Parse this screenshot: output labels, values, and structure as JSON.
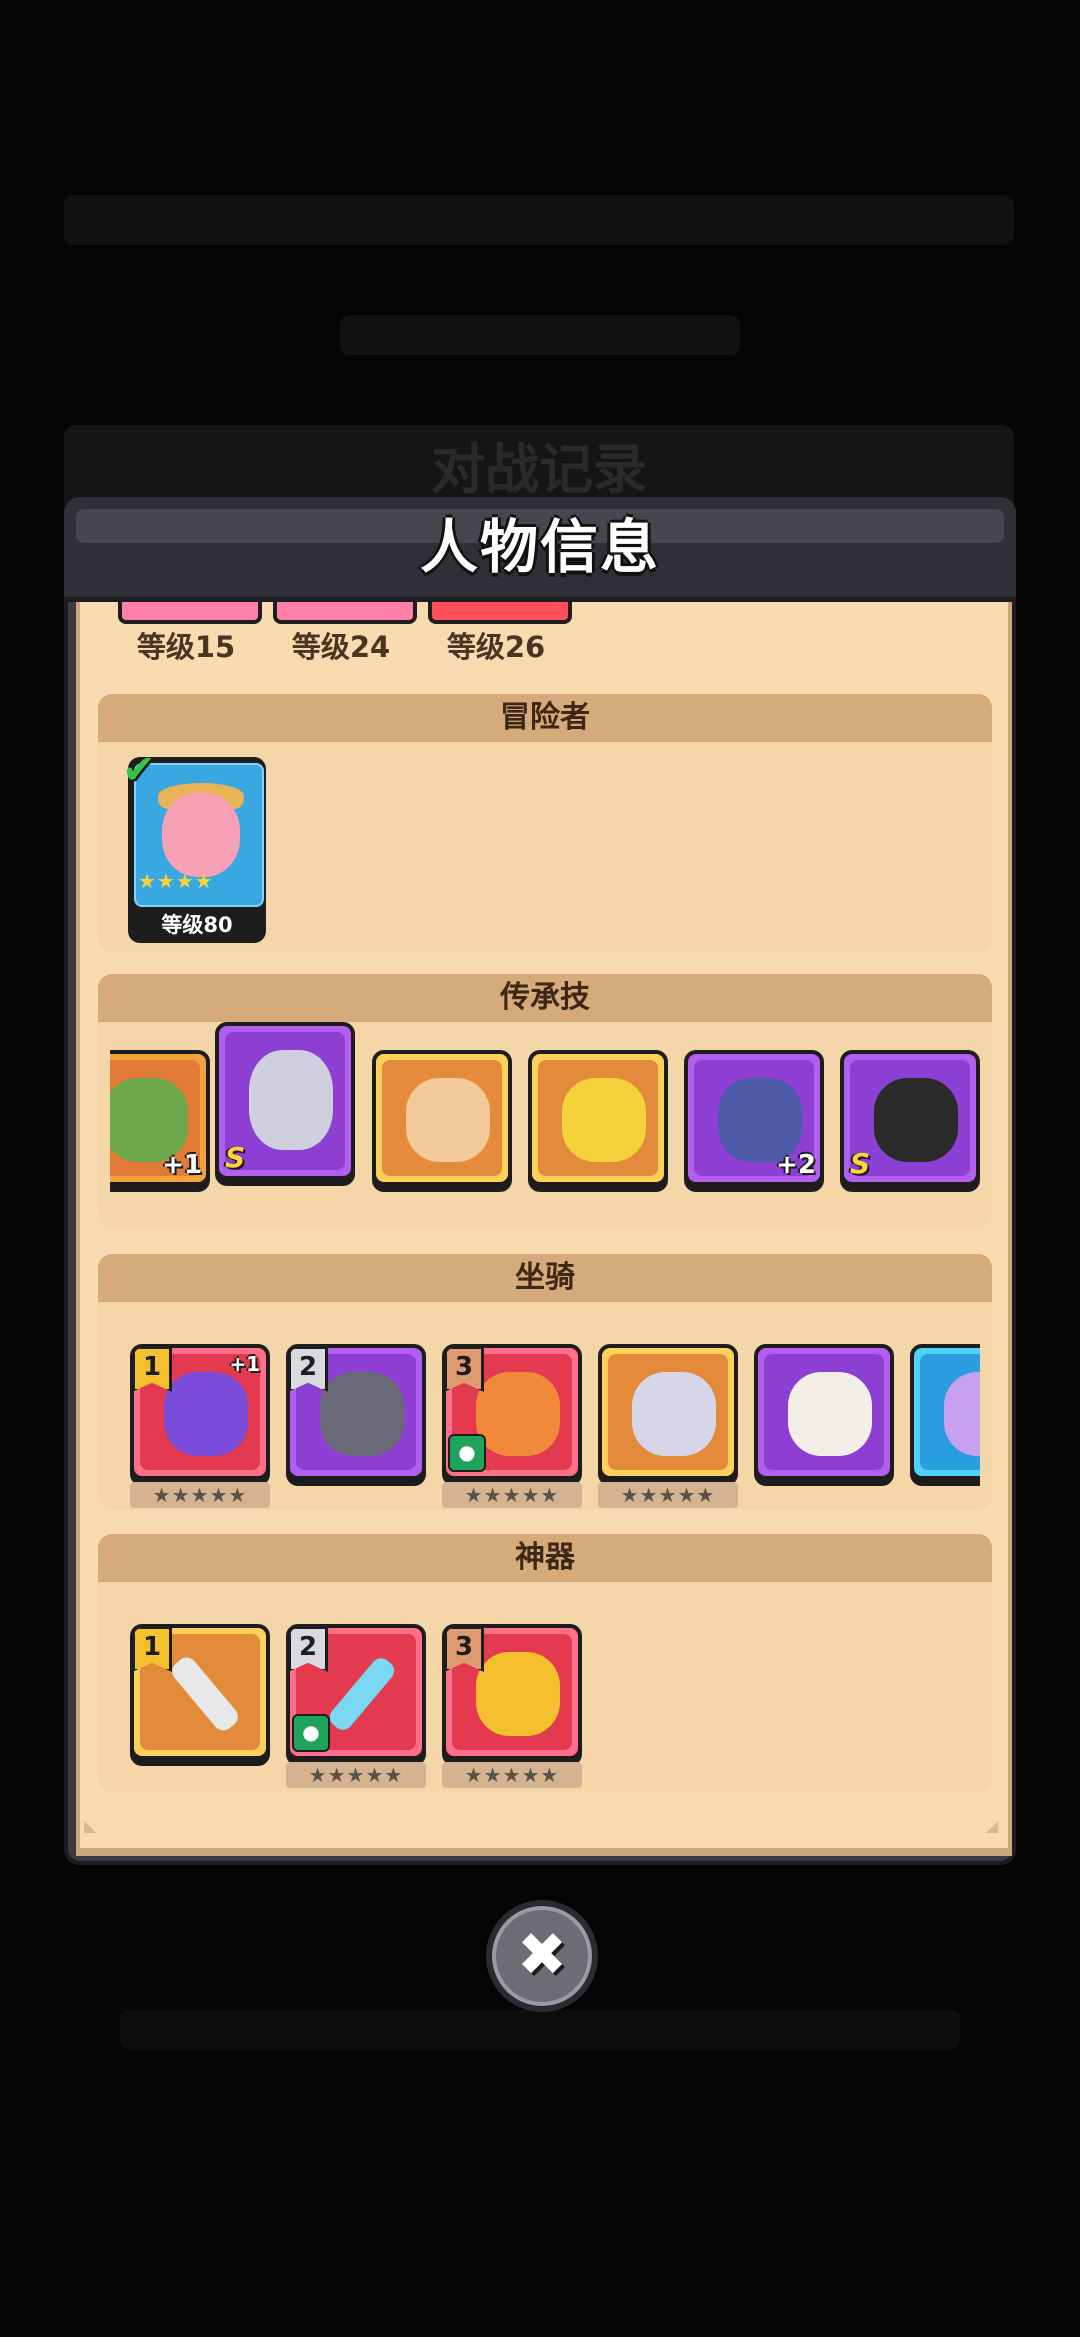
{
  "background": {
    "battle_record_title": "对战记录"
  },
  "modal": {
    "title": "人物信息"
  },
  "levels": [
    "等级15",
    "等级24",
    "等级26"
  ],
  "sections": {
    "adventurer": "冒险者",
    "legacy": "传承技",
    "mount": "坐骑",
    "artifact": "神器"
  },
  "adventurer": {
    "level_label": "等级80",
    "stars": "★★★★",
    "selected": "✔"
  },
  "legacy_badges": {
    "plus1": "+1",
    "s1": "S",
    "plus2": "+2",
    "s2": "S"
  },
  "mounts": {
    "tag1": "1",
    "tag2": "2",
    "tag3": "3",
    "plus1": "+1",
    "stars": "★★★★★"
  },
  "artifacts": {
    "tag1": "1",
    "tag2": "2",
    "tag3": "3",
    "stars": "★★★★★"
  },
  "close": {
    "icon": "✖"
  }
}
